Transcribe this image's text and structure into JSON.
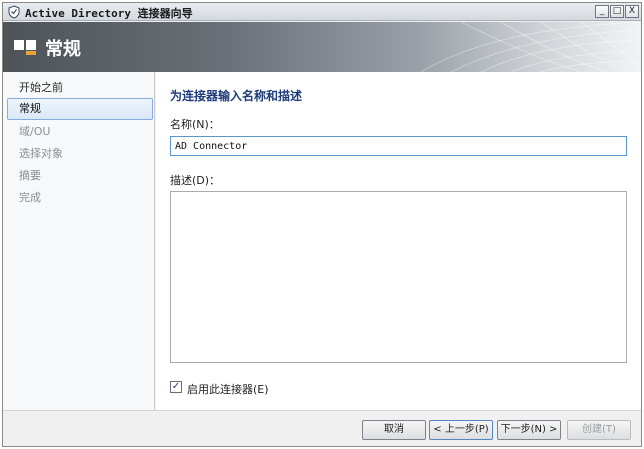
{
  "window": {
    "title": "Active Directory 连接器向导",
    "controls": {
      "minimize": "_",
      "maximize": "□",
      "close": "X"
    }
  },
  "banner": {
    "title": "常规",
    "icon": "connector-blocks-icon"
  },
  "nav": {
    "items": [
      {
        "label": "开始之前",
        "state": "normal"
      },
      {
        "label": "常规",
        "state": "selected"
      },
      {
        "label": "域/OU",
        "state": "muted"
      },
      {
        "label": "选择对象",
        "state": "muted"
      },
      {
        "label": "摘要",
        "state": "muted"
      },
      {
        "label": "完成",
        "state": "muted"
      }
    ]
  },
  "main": {
    "heading": "为连接器输入名称和描述",
    "name_label": "名称(N)：",
    "name_value": "AD Connector",
    "description_label": "描述(D)：",
    "description_value": "",
    "enable_checkbox": {
      "label": "启用此连接器(E)",
      "checked": true,
      "mark": "✓"
    }
  },
  "footer": {
    "cancel": "取消",
    "previous": "< 上一步(P)",
    "next": "下一步(N) >",
    "create": "创建(T)"
  },
  "colors": {
    "heading": "#1f3c7a",
    "selection_border": "#84acdd",
    "input_focus_border": "#5b97cf"
  }
}
